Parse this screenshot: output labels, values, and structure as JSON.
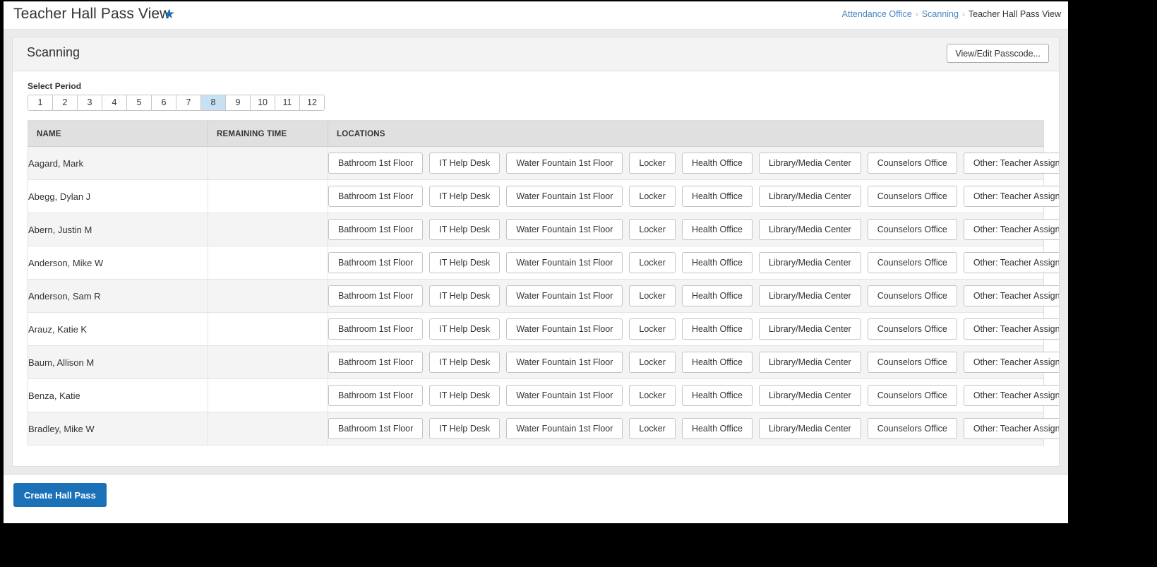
{
  "window": {
    "title": "Teacher Hall Pass View",
    "favorite_icon": "star-icon",
    "accent_color": "#1a71b8",
    "selected_period_color": "#c7e1f2"
  },
  "breadcrumb": {
    "items": [
      "Attendance Office",
      "Scanning",
      "Teacher Hall Pass View"
    ],
    "separator": "›"
  },
  "card": {
    "title": "Scanning",
    "passcode_button": "View/Edit Passcode..."
  },
  "period_selector": {
    "label": "Select Period",
    "options": [
      "1",
      "2",
      "3",
      "4",
      "5",
      "6",
      "7",
      "8",
      "9",
      "10",
      "11",
      "12"
    ],
    "selected": "8"
  },
  "table": {
    "headers": [
      "NAME",
      "REMAINING TIME",
      "LOCATIONS"
    ],
    "locations": [
      "Bathroom 1st Floor",
      "IT Help Desk",
      "Water Fountain 1st Floor",
      "Locker",
      "Health Office",
      "Library/Media Center",
      "Counselors Office",
      "Other: Teacher Assigned"
    ],
    "rows": [
      {
        "name": "Aagard, Mark",
        "remaining_time": ""
      },
      {
        "name": "Abegg, Dylan J",
        "remaining_time": ""
      },
      {
        "name": "Abern, Justin M",
        "remaining_time": ""
      },
      {
        "name": "Anderson, Mike W",
        "remaining_time": ""
      },
      {
        "name": "Anderson, Sam R",
        "remaining_time": ""
      },
      {
        "name": "Arauz, Katie K",
        "remaining_time": ""
      },
      {
        "name": "Baum, Allison M",
        "remaining_time": ""
      },
      {
        "name": "Benza, Katie",
        "remaining_time": ""
      },
      {
        "name": "Bradley, Mike W",
        "remaining_time": ""
      }
    ]
  },
  "footer": {
    "create_button": "Create Hall Pass"
  }
}
